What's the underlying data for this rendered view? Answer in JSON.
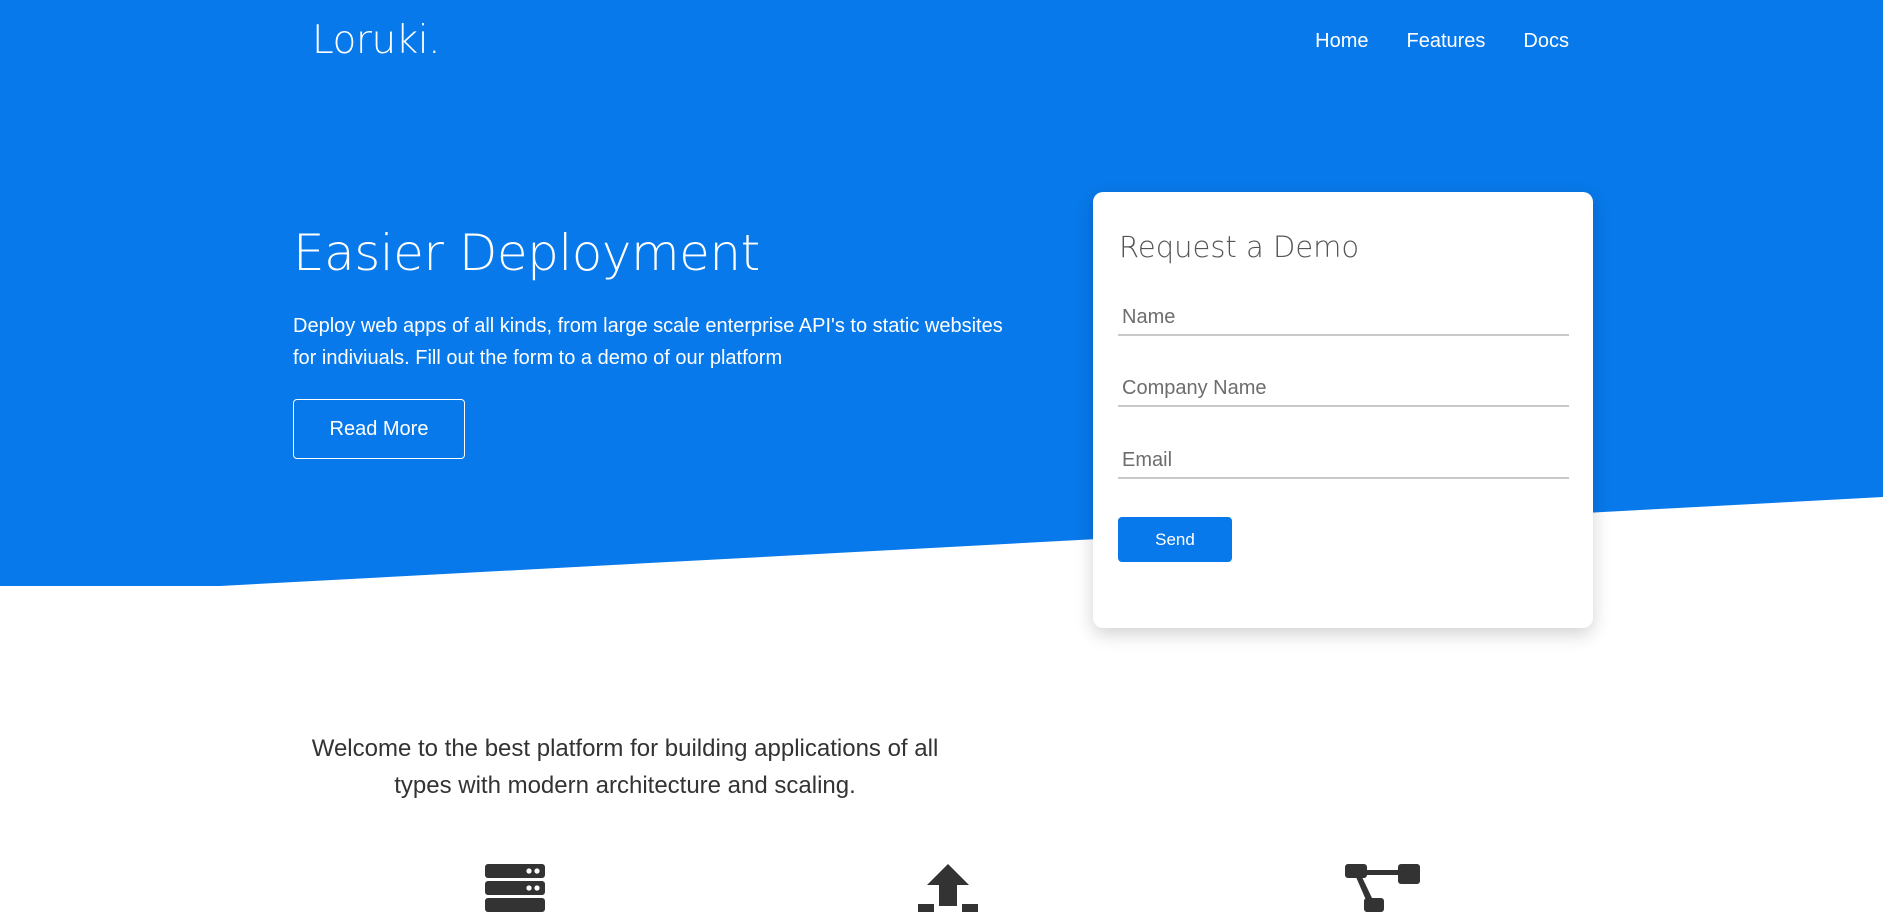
{
  "colors": {
    "primary": "#0879ea",
    "text_dark": "#333333",
    "white": "#ffffff"
  },
  "nav": {
    "brand": "Loruki.",
    "links": [
      {
        "label": "Home"
      },
      {
        "label": "Features"
      },
      {
        "label": "Docs"
      }
    ]
  },
  "hero": {
    "title": "Easier Deployment",
    "description": "Deploy web apps of all kinds, from large scale enterprise API's to static websites for indiviuals. Fill out the form to a demo of our platform",
    "button_label": "Read More"
  },
  "demo_form": {
    "title": "Request a Demo",
    "fields": {
      "name": {
        "placeholder": "Name",
        "value": ""
      },
      "company": {
        "placeholder": "Company Name",
        "value": ""
      },
      "email": {
        "placeholder": "Email",
        "value": ""
      }
    },
    "submit_label": "Send"
  },
  "welcome": {
    "text": "Welcome to the best platform for building applications of all types with modern architecture and scaling."
  },
  "features": {
    "icons": [
      "server-icon",
      "upload-icon",
      "sitemap-icon"
    ]
  }
}
